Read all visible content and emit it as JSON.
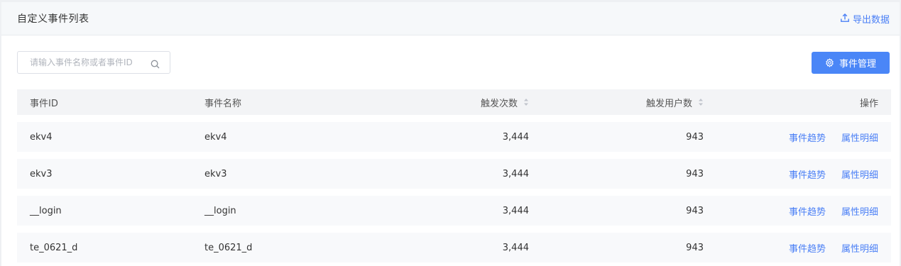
{
  "header": {
    "title": "自定义事件列表",
    "export_label": "导出数据"
  },
  "toolbar": {
    "search_placeholder": "请输入事件名称或者事件ID",
    "manage_label": "事件管理"
  },
  "table": {
    "columns": {
      "id": "事件ID",
      "name": "事件名称",
      "count": "触发次数",
      "users": "触发用户数",
      "ops": "操作"
    },
    "op_labels": {
      "trend": "事件趋势",
      "detail": "属性明细"
    },
    "rows": [
      {
        "id": "ekv4",
        "name": "ekv4",
        "count": "3,444",
        "users": "943"
      },
      {
        "id": "ekv3",
        "name": "ekv3",
        "count": "3,444",
        "users": "943"
      },
      {
        "id": "__login",
        "name": "__login",
        "count": "3,444",
        "users": "943"
      },
      {
        "id": "te_0621_d",
        "name": "te_0621_d",
        "count": "3,444",
        "users": "943"
      }
    ]
  },
  "colors": {
    "accent": "#4a86f7",
    "link": "#4a7ff6",
    "header_bg": "#f6f8fa",
    "row_bg": "#f8f9fb"
  },
  "icons": {
    "export": "upload-icon",
    "search": "search-icon",
    "manage": "gear-icon",
    "sort": "sort-icon"
  }
}
